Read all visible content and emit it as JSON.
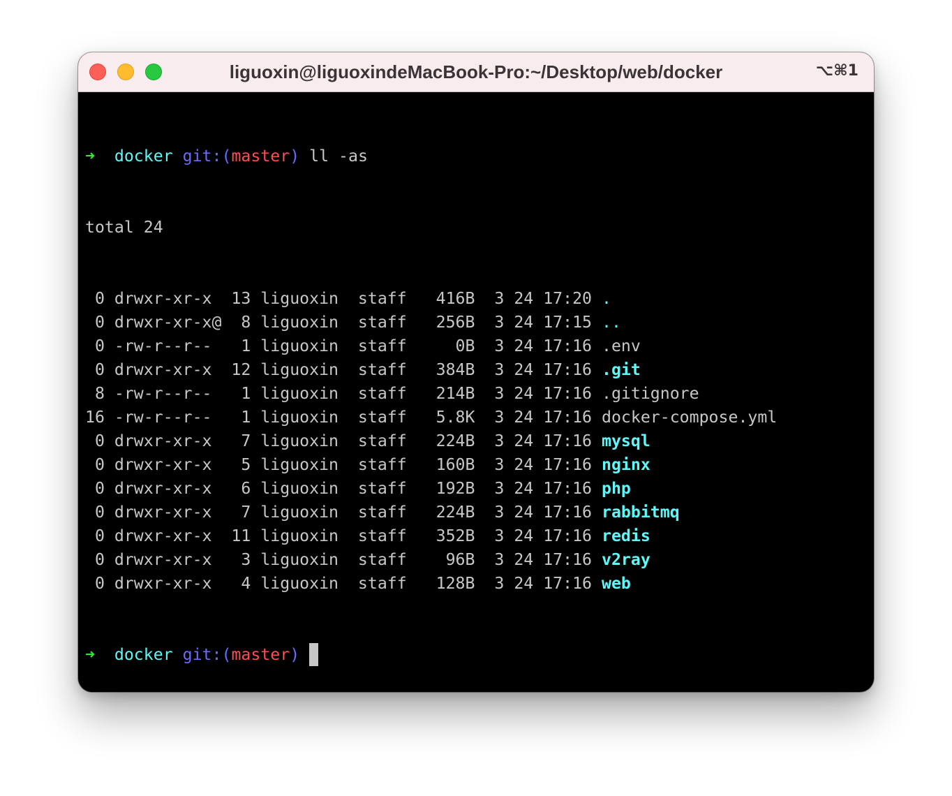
{
  "window": {
    "title": "liguoxin@liguoxindeMacBook-Pro:~/Desktop/web/docker",
    "shortcut": "⌥⌘1"
  },
  "colors": {
    "prompt_arrow": "#37e63a",
    "dir": "#5ff7f7",
    "git": "#6b6bfb",
    "branch": "#ff4d52",
    "text": "#c7c7c7",
    "background": "#000000"
  },
  "prompt": {
    "arrow": "➜",
    "dir": "docker",
    "git_open": "git:(",
    "branch": "master",
    "git_close": ")",
    "command": "ll -as"
  },
  "total_line": "total 24",
  "listing": [
    {
      "blocks": " 0",
      "perms": "drwxr-xr-x ",
      "links": "13",
      "owner": "liguoxin",
      "group": "staff",
      "size": "416B",
      "month": "3",
      "day": "24",
      "time": "17:20",
      "name": ".",
      "style": "dir-thin"
    },
    {
      "blocks": " 0",
      "perms": "drwxr-xr-x@",
      "links": " 8",
      "owner": "liguoxin",
      "group": "staff",
      "size": "256B",
      "month": "3",
      "day": "24",
      "time": "17:15",
      "name": "..",
      "style": "dir-thin"
    },
    {
      "blocks": " 0",
      "perms": "-rw-r--r-- ",
      "links": " 1",
      "owner": "liguoxin",
      "group": "staff",
      "size": "  0B",
      "month": "3",
      "day": "24",
      "time": "17:16",
      "name": ".env",
      "style": "file"
    },
    {
      "blocks": " 0",
      "perms": "drwxr-xr-x ",
      "links": "12",
      "owner": "liguoxin",
      "group": "staff",
      "size": "384B",
      "month": "3",
      "day": "24",
      "time": "17:16",
      "name": ".git",
      "style": "dir"
    },
    {
      "blocks": " 8",
      "perms": "-rw-r--r-- ",
      "links": " 1",
      "owner": "liguoxin",
      "group": "staff",
      "size": "214B",
      "month": "3",
      "day": "24",
      "time": "17:16",
      "name": ".gitignore",
      "style": "file"
    },
    {
      "blocks": "16",
      "perms": "-rw-r--r-- ",
      "links": " 1",
      "owner": "liguoxin",
      "group": "staff",
      "size": "5.8K",
      "month": "3",
      "day": "24",
      "time": "17:16",
      "name": "docker-compose.yml",
      "style": "file"
    },
    {
      "blocks": " 0",
      "perms": "drwxr-xr-x ",
      "links": " 7",
      "owner": "liguoxin",
      "group": "staff",
      "size": "224B",
      "month": "3",
      "day": "24",
      "time": "17:16",
      "name": "mysql",
      "style": "dir"
    },
    {
      "blocks": " 0",
      "perms": "drwxr-xr-x ",
      "links": " 5",
      "owner": "liguoxin",
      "group": "staff",
      "size": "160B",
      "month": "3",
      "day": "24",
      "time": "17:16",
      "name": "nginx",
      "style": "dir"
    },
    {
      "blocks": " 0",
      "perms": "drwxr-xr-x ",
      "links": " 6",
      "owner": "liguoxin",
      "group": "staff",
      "size": "192B",
      "month": "3",
      "day": "24",
      "time": "17:16",
      "name": "php",
      "style": "dir"
    },
    {
      "blocks": " 0",
      "perms": "drwxr-xr-x ",
      "links": " 7",
      "owner": "liguoxin",
      "group": "staff",
      "size": "224B",
      "month": "3",
      "day": "24",
      "time": "17:16",
      "name": "rabbitmq",
      "style": "dir"
    },
    {
      "blocks": " 0",
      "perms": "drwxr-xr-x ",
      "links": "11",
      "owner": "liguoxin",
      "group": "staff",
      "size": "352B",
      "month": "3",
      "day": "24",
      "time": "17:16",
      "name": "redis",
      "style": "dir"
    },
    {
      "blocks": " 0",
      "perms": "drwxr-xr-x ",
      "links": " 3",
      "owner": "liguoxin",
      "group": "staff",
      "size": " 96B",
      "month": "3",
      "day": "24",
      "time": "17:16",
      "name": "v2ray",
      "style": "dir"
    },
    {
      "blocks": " 0",
      "perms": "drwxr-xr-x ",
      "links": " 4",
      "owner": "liguoxin",
      "group": "staff",
      "size": "128B",
      "month": "3",
      "day": "24",
      "time": "17:16",
      "name": "web",
      "style": "dir"
    }
  ],
  "final_prompt": {
    "arrow": "➜",
    "dir": "docker",
    "git_open": "git:(",
    "branch": "master",
    "git_close": ")"
  }
}
